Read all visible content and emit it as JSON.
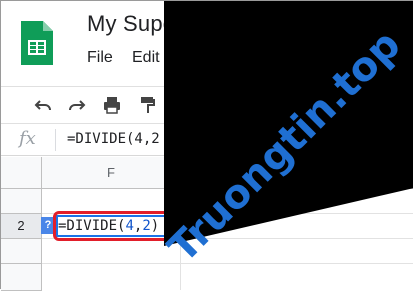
{
  "header": {
    "doc_title": "My Supe",
    "menu": {
      "file": "File",
      "edit": "Edit"
    },
    "logo_icon": "google-sheets-logo"
  },
  "toolbar": {
    "icons": [
      "undo-icon",
      "redo-icon",
      "print-icon",
      "paint-format-icon"
    ]
  },
  "formula_bar": {
    "fx_label": "fx",
    "content": "=DIVIDE(4,2"
  },
  "grid": {
    "column_headers": [
      "F"
    ],
    "row_headers": [
      "",
      "2",
      "",
      ""
    ],
    "active_cell": {
      "prefix": "=DIVIDE(",
      "arg1": "4",
      "comma": ",",
      "arg2": "2",
      "suffix": ")"
    },
    "help_badge": "?"
  },
  "watermark": {
    "text": "Truongtin.top",
    "color": "#1f6fd2"
  },
  "colors": {
    "accent": "#1a73e8",
    "highlight": "#e21e2a",
    "sheets_green": "#0f9d58"
  }
}
